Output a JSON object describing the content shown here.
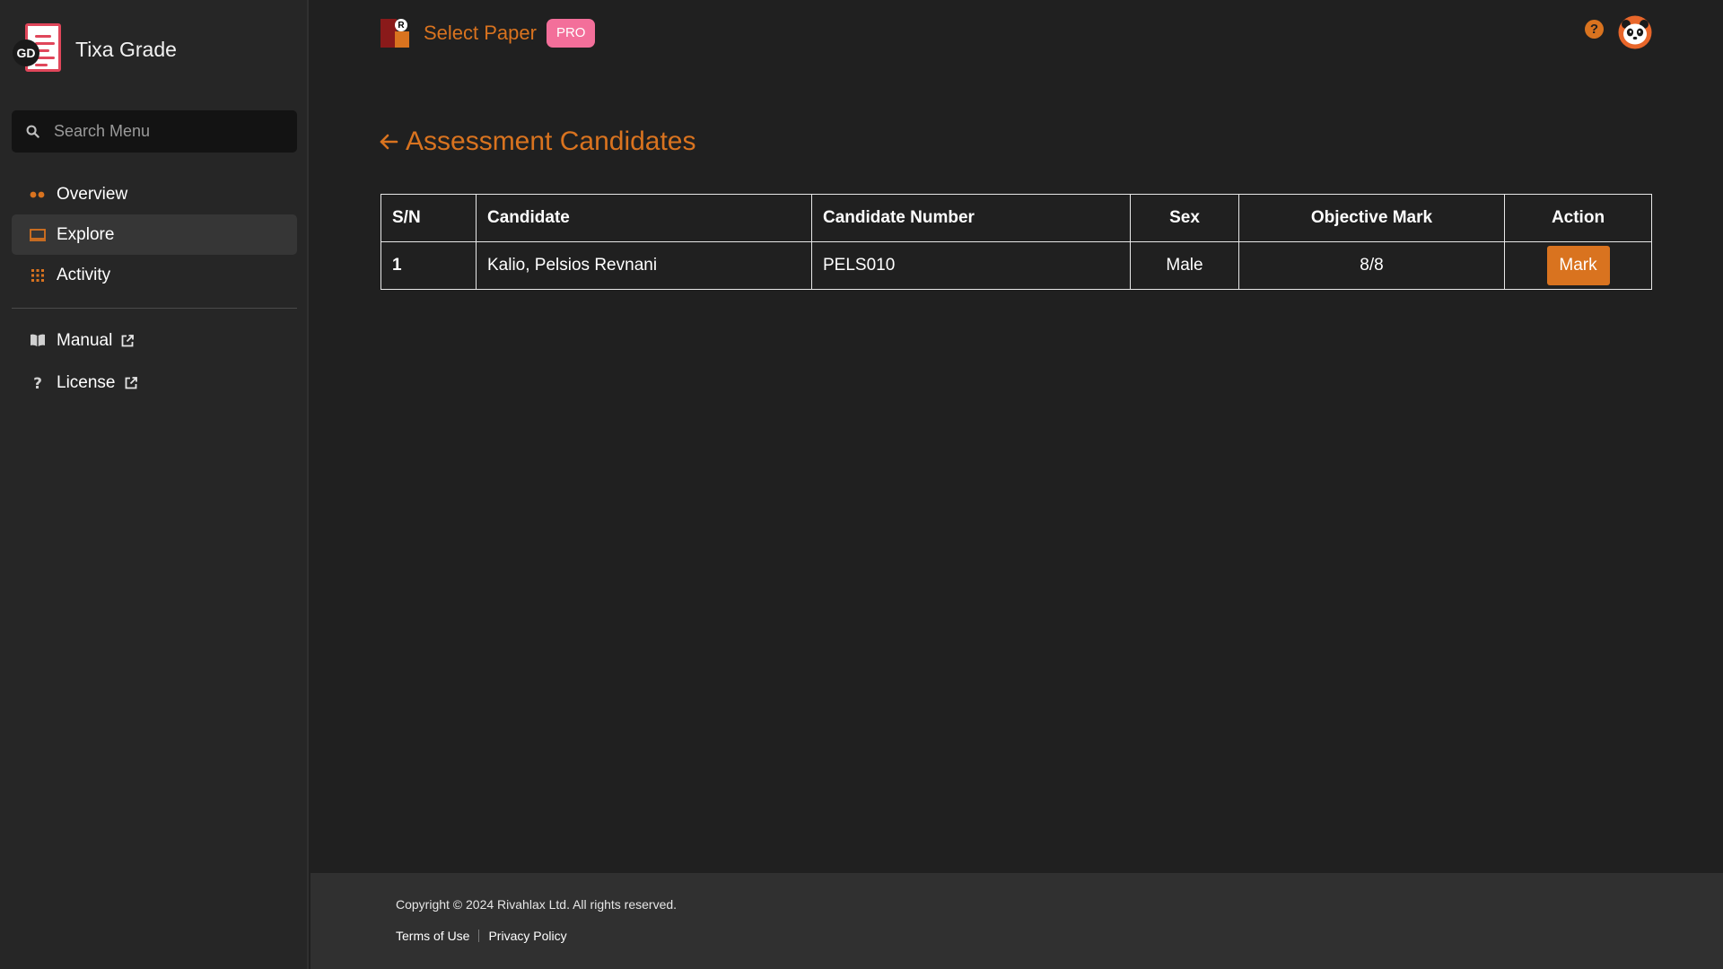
{
  "sidebar": {
    "brand_badge": "GD",
    "brand_name": "Tixa Grade",
    "search_placeholder": "Search Menu",
    "nav": [
      {
        "label": "Overview",
        "icon": "dots-icon",
        "active": false
      },
      {
        "label": "Explore",
        "icon": "monitor-icon",
        "active": true
      },
      {
        "label": "Activity",
        "icon": "grid-icon",
        "active": false
      }
    ],
    "links": [
      {
        "label": "Manual",
        "icon": "book-icon"
      },
      {
        "label": "License",
        "icon": "question-icon"
      }
    ]
  },
  "topbar": {
    "logo_mark": "R",
    "select_paper": "Select Paper",
    "badge": "PRO",
    "help": "?"
  },
  "main": {
    "title": "Assessment Candidates",
    "table": {
      "headers": [
        "S/N",
        "Candidate",
        "Candidate Number",
        "Sex",
        "Objective Mark",
        "Action"
      ],
      "rows": [
        {
          "sn": "1",
          "candidate": "Kalio, Pelsios Revnani",
          "number": "PELS010",
          "sex": "Male",
          "mark": "8/8",
          "action": "Mark"
        }
      ]
    }
  },
  "footer": {
    "copyright": "Copyright © 2024 Rivahlax Ltd. All rights reserved.",
    "terms": "Terms of Use",
    "privacy": "Privacy Policy"
  },
  "colors": {
    "accent": "#d9731f",
    "pro_badge": "#f36f9a",
    "background": "#202020",
    "sidebar": "#262626"
  }
}
